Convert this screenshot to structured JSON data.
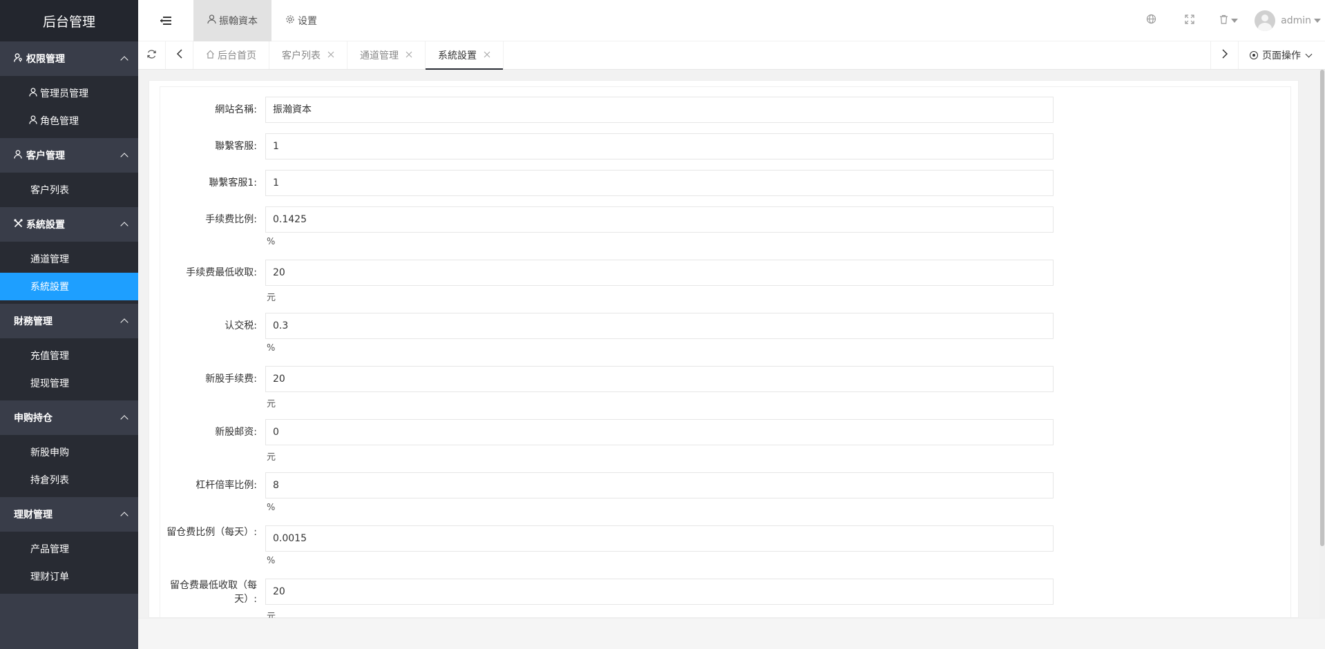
{
  "app": {
    "title": "后台管理"
  },
  "sidebar": {
    "groups": [
      {
        "title": "权限管理",
        "icon": "user-key-icon",
        "items": [
          {
            "label": "管理员管理",
            "icon": "user-icon"
          },
          {
            "label": "角色管理",
            "icon": "user-icon"
          }
        ]
      },
      {
        "title": "客户管理",
        "icon": "user-icon",
        "items": [
          {
            "label": "客户列表"
          }
        ]
      },
      {
        "title": "系統設置",
        "icon": "tools-icon",
        "items": [
          {
            "label": "通道管理"
          },
          {
            "label": "系統設置",
            "active": true
          }
        ]
      },
      {
        "title": "財務管理",
        "items": [
          {
            "label": "充值管理"
          },
          {
            "label": "提现管理"
          }
        ]
      },
      {
        "title": "申购持仓",
        "items": [
          {
            "label": "新股申购"
          },
          {
            "label": "持倉列表"
          }
        ]
      },
      {
        "title": "理财管理",
        "items": [
          {
            "label": "产品管理"
          },
          {
            "label": "理财订单"
          }
        ]
      }
    ]
  },
  "header": {
    "tabs": [
      {
        "label": "振翰資本",
        "icon": "user-icon",
        "active": true
      },
      {
        "label": "设置",
        "icon": "gear-icon"
      }
    ],
    "user": "admin"
  },
  "pagetabs": {
    "tabs": [
      {
        "label": "后台首页",
        "icon": "home-icon"
      },
      {
        "label": "客户列表",
        "closable": true
      },
      {
        "label": "通道管理",
        "closable": true
      },
      {
        "label": "系統設置",
        "closable": true,
        "active": true
      }
    ],
    "page_ops": "页面操作"
  },
  "form": {
    "fields": [
      {
        "label": "網站名稱:",
        "value": "振瀚資本"
      },
      {
        "label": "聯繫客服:",
        "value": "1"
      },
      {
        "label": "聯繫客服1:",
        "value": "1"
      },
      {
        "label": "手续费比例:",
        "value": "0.1425",
        "unit": "%"
      },
      {
        "label": "手续费最低收取:",
        "value": "20",
        "unit": "元"
      },
      {
        "label": "认交税:",
        "value": "0.3",
        "unit": "%"
      },
      {
        "label": "新股手续费:",
        "value": "20",
        "unit": "元"
      },
      {
        "label": "新股邮资:",
        "value": "0",
        "unit": "元"
      },
      {
        "label": "杠杆倍率比例:",
        "value": "8",
        "unit": "%"
      },
      {
        "label": "留仓费比例（每天）:",
        "value": "0.0015",
        "unit": "%"
      },
      {
        "label": "留仓费最低收取（每天）:",
        "value": "20",
        "unit": "元"
      }
    ]
  }
}
